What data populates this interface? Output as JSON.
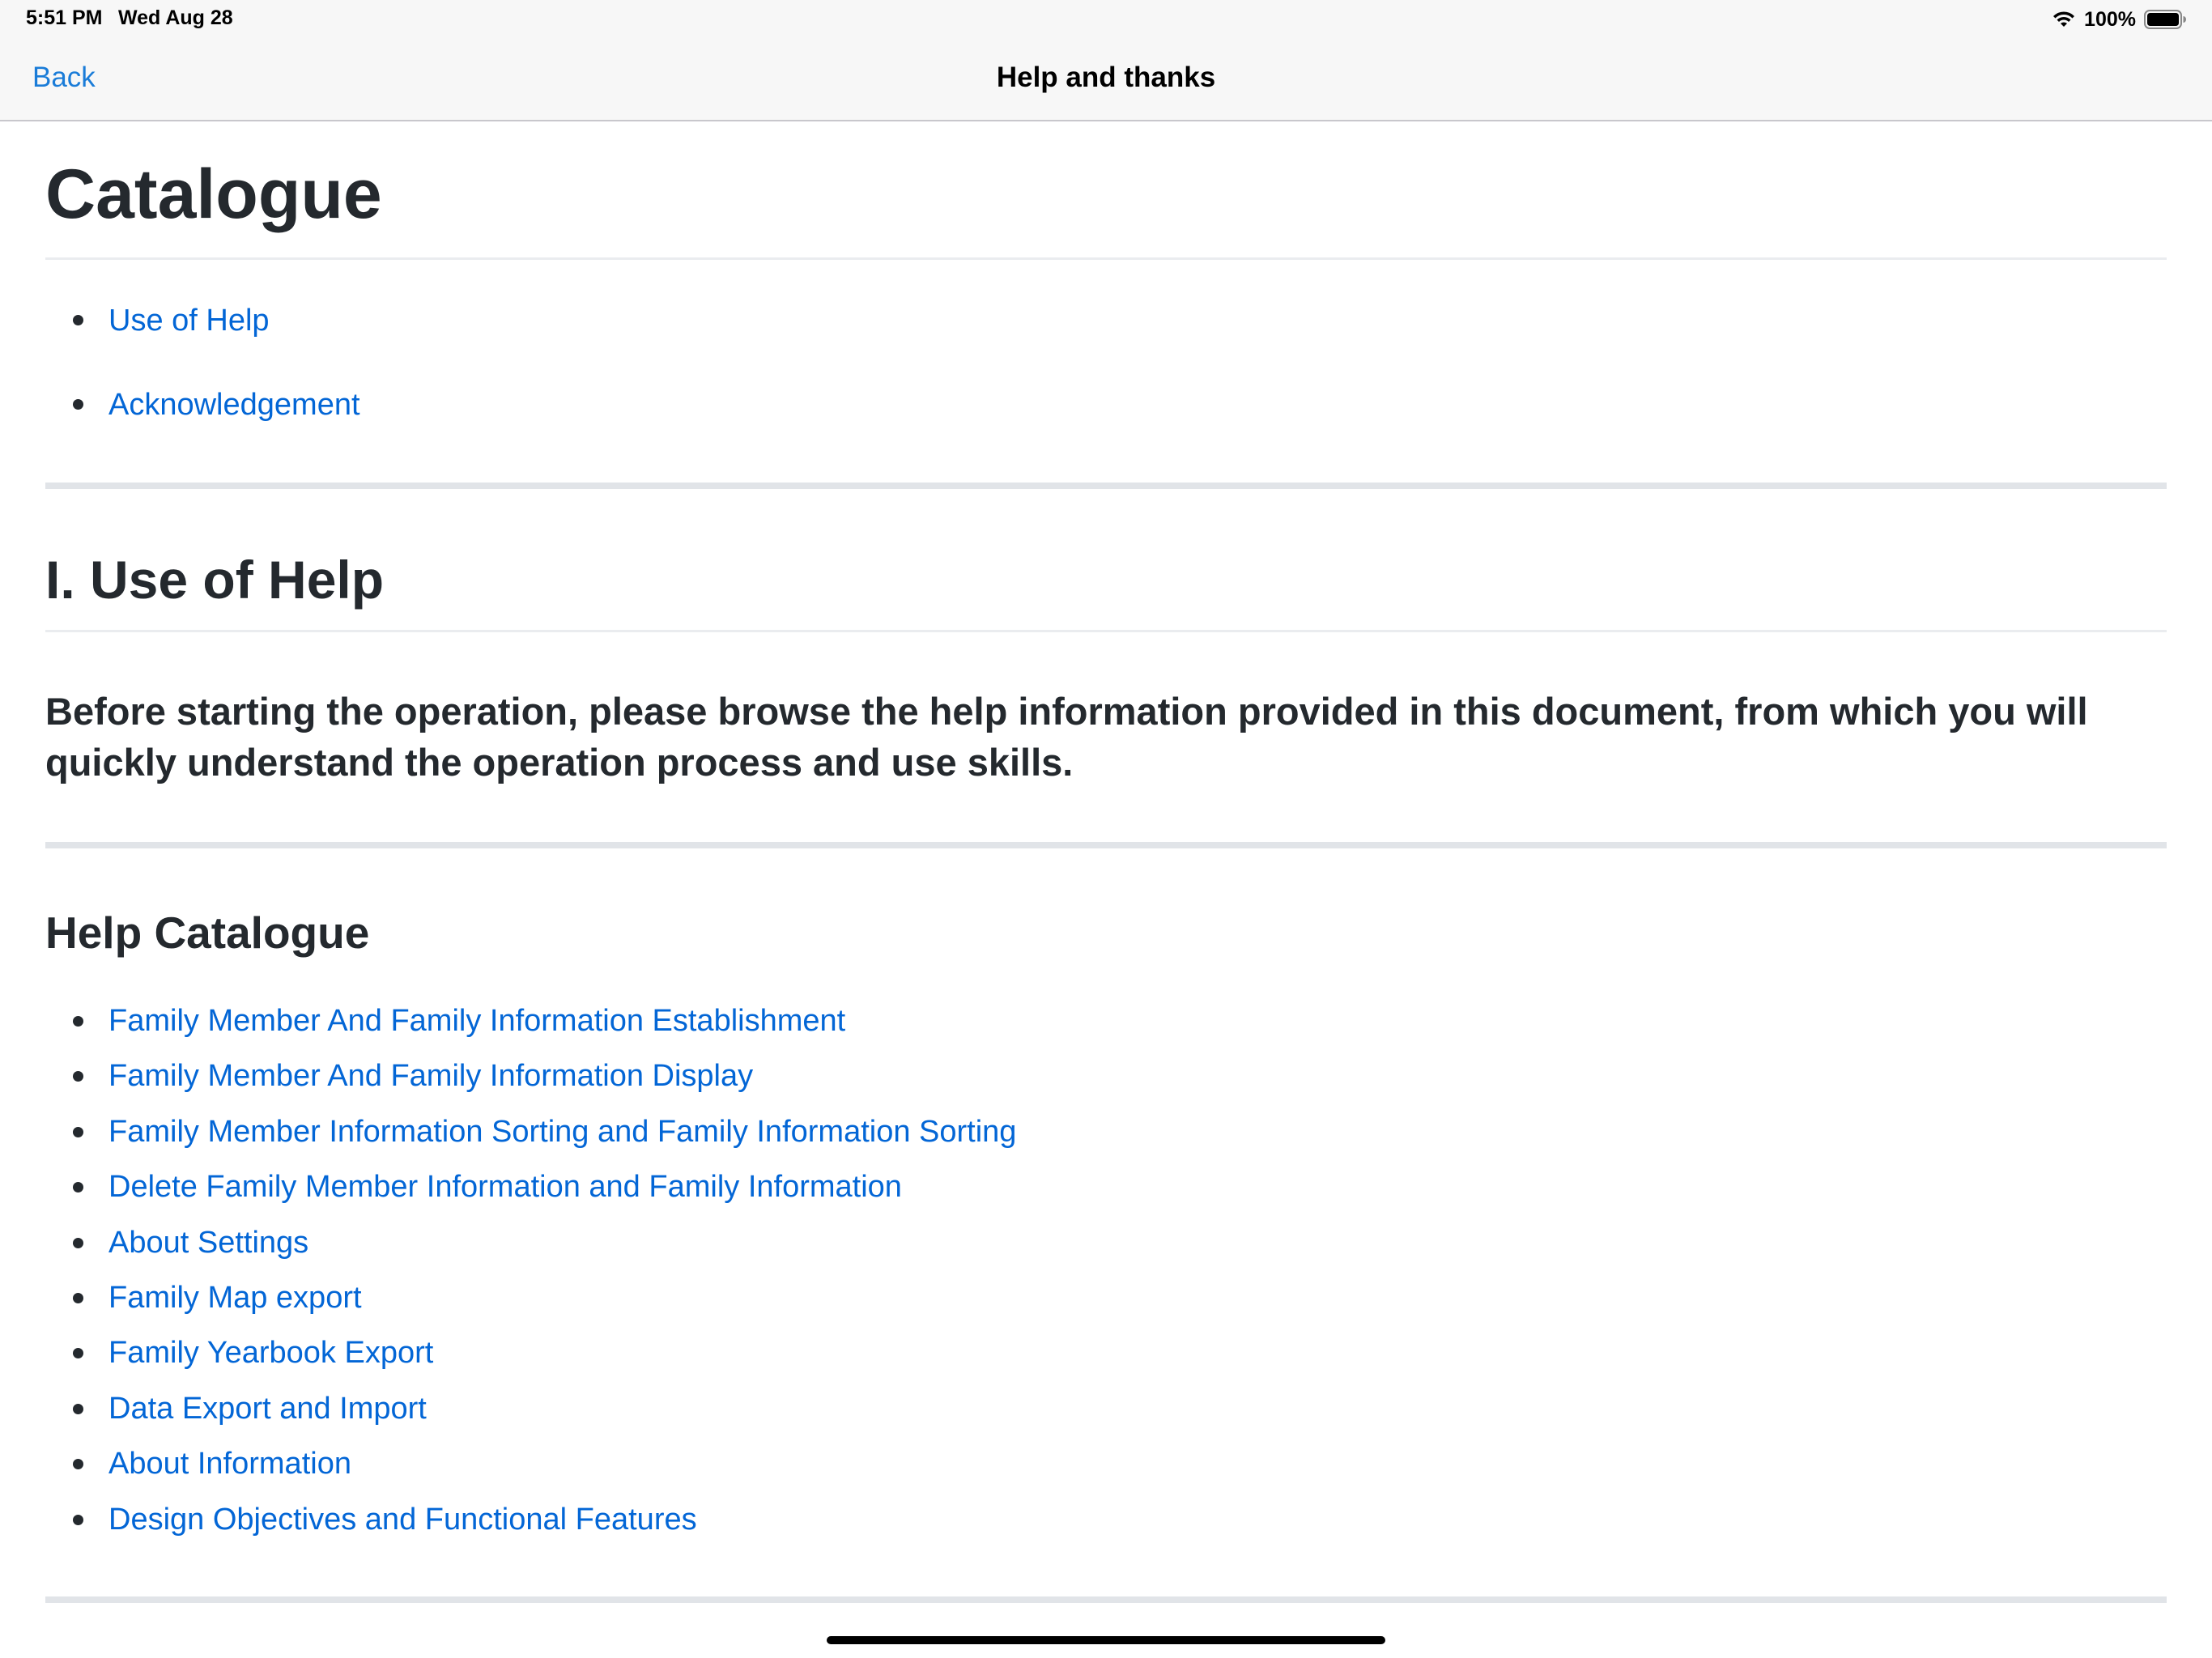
{
  "status_bar": {
    "time": "5:51 PM",
    "date": "Wed Aug 28",
    "battery_text": "100%",
    "icons": [
      "wifi-icon",
      "battery-icon"
    ]
  },
  "nav": {
    "back_label": "Back",
    "title": "Help and thanks"
  },
  "catalogue": {
    "title": "Catalogue",
    "items": [
      {
        "label": "Use of Help"
      },
      {
        "label": "Acknowledgement"
      }
    ]
  },
  "use_of_help": {
    "title": "I. Use of Help",
    "intro": "Before starting the operation, please browse the help information provided in this document, from which you will quickly understand the operation process and use skills."
  },
  "help_catalogue": {
    "title": "Help Catalogue",
    "items": [
      {
        "label": "Family Member And Family Information Establishment"
      },
      {
        "label": "Family Member And Family Information Display"
      },
      {
        "label": "Family Member Information Sorting and Family Information Sorting"
      },
      {
        "label": "Delete Family Member Information and Family Information"
      },
      {
        "label": "About Settings"
      },
      {
        "label": "Family Map export"
      },
      {
        "label": "Family Yearbook Export"
      },
      {
        "label": "Data Export and Import"
      },
      {
        "label": "About Information"
      },
      {
        "label": "Design Objectives and Functional Features"
      }
    ]
  },
  "colors": {
    "link": "#0366d6",
    "nav_link": "#1a7cd8",
    "text": "#24292e",
    "bar_bg": "#f7f7f7"
  }
}
